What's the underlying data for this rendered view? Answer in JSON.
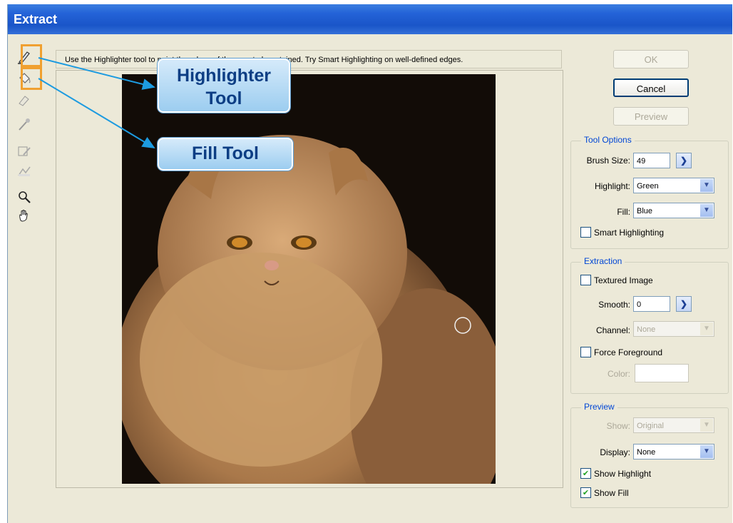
{
  "window": {
    "title": "Extract"
  },
  "instructions": "Use the Highlighter tool to paint the edges of the area to be retained. Try Smart Highlighting on well-defined edges.",
  "callouts": {
    "highlighter": [
      "Highlighter",
      "Tool"
    ],
    "fill": "Fill Tool"
  },
  "tools": [
    {
      "name": "highlighter-icon"
    },
    {
      "name": "fill-bucket-icon"
    },
    {
      "name": "eraser-icon"
    },
    {
      "name": "eyedropper-icon"
    },
    {
      "name": "cleanup-icon"
    },
    {
      "name": "edge-touchup-icon"
    },
    {
      "name": "zoom-icon"
    },
    {
      "name": "hand-icon"
    }
  ],
  "buttons": {
    "ok": "OK",
    "cancel": "Cancel",
    "preview": "Preview"
  },
  "tool_options": {
    "title": "Tool Options",
    "brush_size_label": "Brush Size:",
    "brush_size": "49",
    "highlight_label": "Highlight:",
    "highlight": "Green",
    "fill_label": "Fill:",
    "fill": "Blue",
    "smart_highlighting": "Smart Highlighting"
  },
  "extraction": {
    "title": "Extraction",
    "textured_image": "Textured Image",
    "smooth_label": "Smooth:",
    "smooth": "0",
    "channel_label": "Channel:",
    "channel": "None",
    "force_foreground": "Force Foreground",
    "color_label": "Color:"
  },
  "preview_group": {
    "title": "Preview",
    "show_label": "Show:",
    "show": "Original",
    "display_label": "Display:",
    "display": "None",
    "show_highlight": "Show Highlight",
    "show_highlight_checked": true,
    "show_fill": "Show Fill",
    "show_fill_checked": true
  },
  "colors": {
    "title_bar": "#2463d8",
    "dialog_bg": "#ece9d8",
    "callout_border": "#f0a030",
    "callout_arrow": "#1d9be0"
  }
}
